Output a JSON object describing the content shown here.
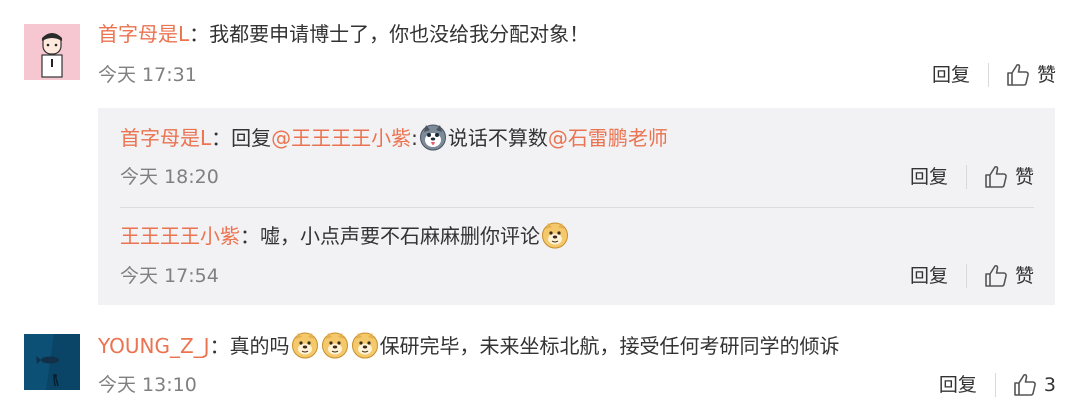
{
  "comments": [
    {
      "user": "首字母是L",
      "colon": "：",
      "text": "我都要申请博士了，你也没给我分配对象！",
      "time": "今天 17:31",
      "reply_label": "回复",
      "like_label": "赞"
    },
    {
      "user": "YOUNG_Z_J",
      "colon": "：",
      "text_before": "真的吗",
      "text_after": "保研完毕，未来坐标北航，接受任何考研同学的倾诉",
      "time": "今天 13:10",
      "reply_label": "回复",
      "like_count": "3"
    }
  ],
  "replies": [
    {
      "user": "首字母是L",
      "colon": "：",
      "reply_word": "回复",
      "mention1": "@王王王王小紫",
      "colon2": ":",
      "text": "说话不算数",
      "mention2": "@石雷鹏老师",
      "time": "今天 18:20",
      "reply_label": "回复",
      "like_label": "赞"
    },
    {
      "user": "王王王王小紫",
      "colon": "：",
      "text": "嘘，小点声要不石麻麻删你评论",
      "time": "今天 17:54",
      "reply_label": "回复",
      "like_label": "赞"
    }
  ],
  "icons": [
    "avatar-cartoon",
    "avatar-ocean",
    "husky-emoji",
    "doge-emoji",
    "thumbs-up-icon"
  ],
  "colors": {
    "username": "#eb7350",
    "time": "#808080",
    "reply_background": "#f2f2f5"
  }
}
